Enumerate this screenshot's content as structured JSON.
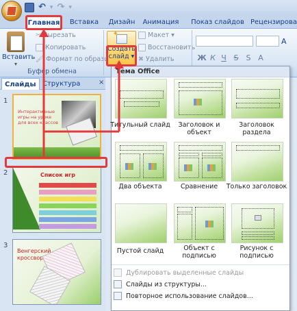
{
  "quick_access": {
    "save_icon": "save-icon",
    "undo_icon": "undo-icon",
    "redo_icon": "redo-icon"
  },
  "tabs": [
    "Главная",
    "Вставка",
    "Дизайн",
    "Анимация",
    "Показ слайдов",
    "Рецензирова"
  ],
  "ribbon": {
    "paste_label": "Вставить",
    "cut_label": "Вырезать",
    "copy_label": "Копировать",
    "format_painter_label": "Формат по образцу",
    "clipboard_group_label": "Буфер обмена",
    "new_slide_label_1": "Создать",
    "new_slide_label_2": "слайд",
    "layout_label": "Макет",
    "reset_label": "Восстановить",
    "delete_label": "Удалить"
  },
  "left_pane": {
    "tab_slides": "Слайды",
    "tab_outline": "Структура",
    "close": "×",
    "slides": [
      {
        "number": "1",
        "title": "Интерактивные игры на уроке для всех классов"
      },
      {
        "number": "2",
        "title": "Список игр"
      },
      {
        "number": "3",
        "title": "Венгерский кроссворд"
      }
    ]
  },
  "dropdown": {
    "header": "Тема Office",
    "layouts": [
      "Титульный слайд",
      "Заголовок и объект",
      "Заголовок раздела",
      "Два объекта",
      "Сравнение",
      "Только заголовок",
      "Пустой слайд",
      "Объект с подписью",
      "Рисунок с подписью"
    ],
    "menu": [
      {
        "label": "Дублировать выделенные слайды",
        "disabled": true
      },
      {
        "label": "Слайды из структуры...",
        "disabled": false
      },
      {
        "label": "Повторное использование слайдов...",
        "disabled": false
      }
    ]
  },
  "colors": {
    "accent_red": "#e03a3a",
    "ribbon_blue": "#15428b",
    "highlight": "#ffc446"
  }
}
